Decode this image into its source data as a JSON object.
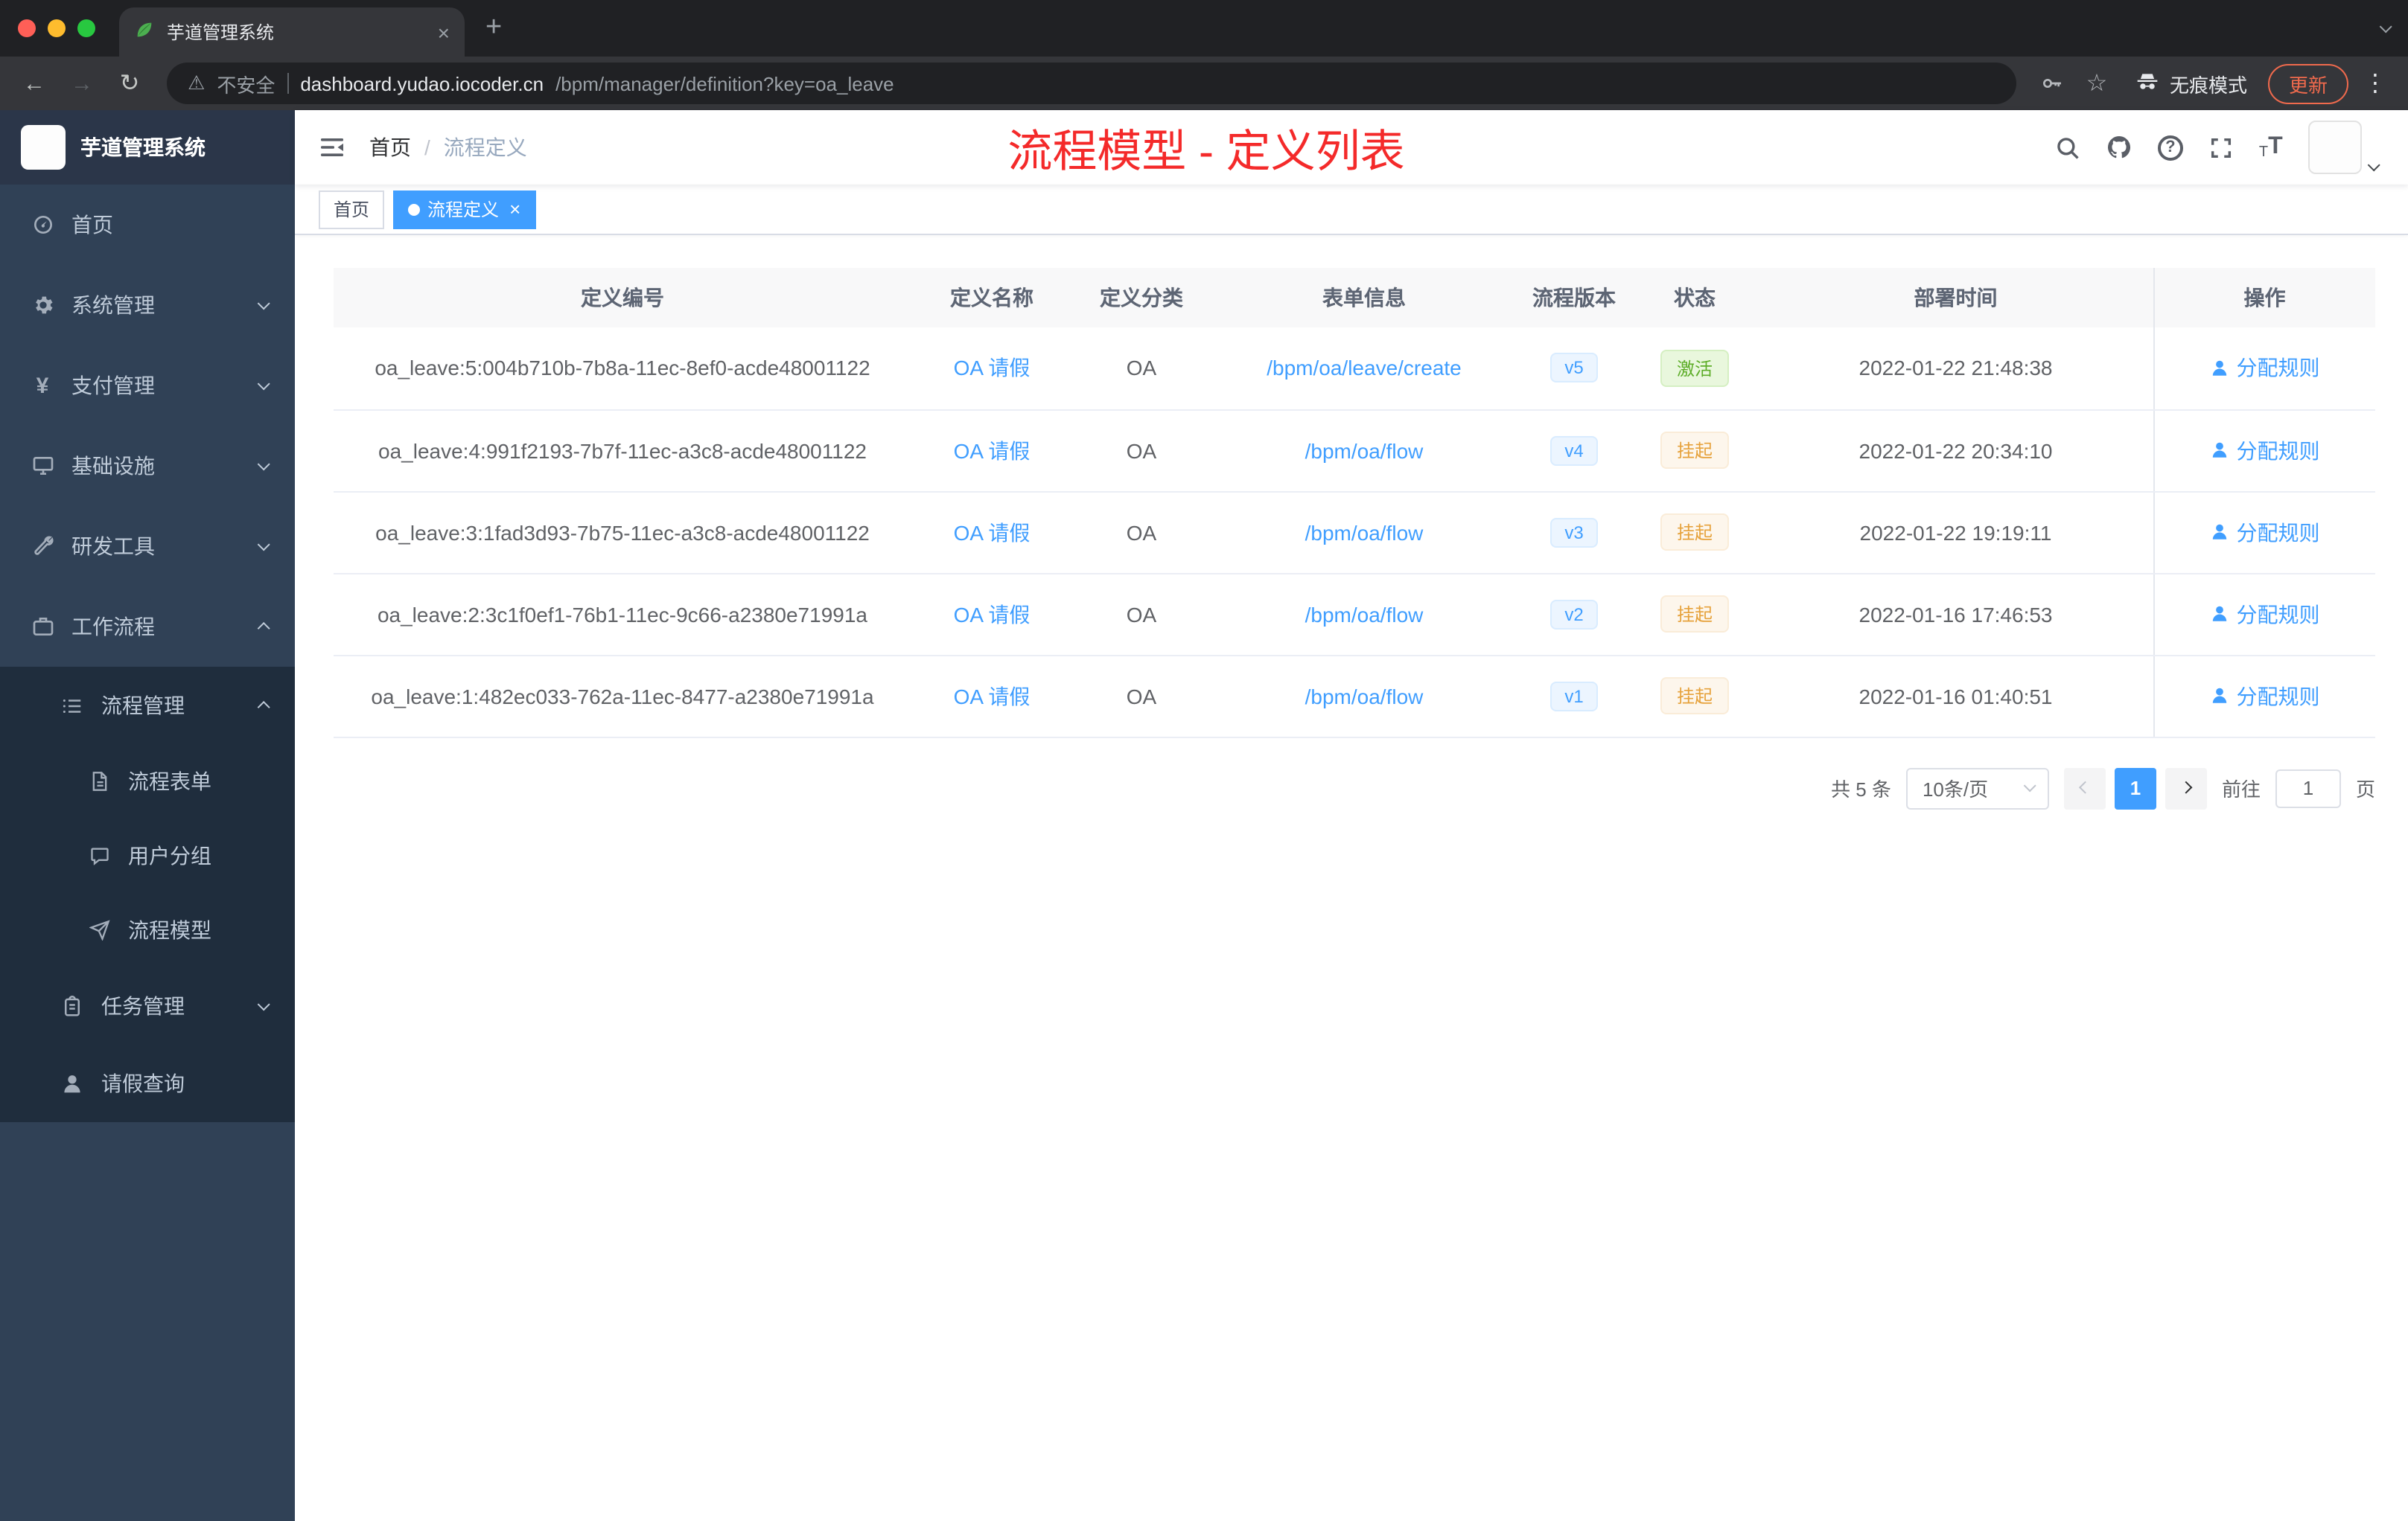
{
  "colors": {
    "accent": "#409eff",
    "success": "#67c23a",
    "warning": "#e6a23c",
    "title_red": "#f42a2a",
    "sidebar_bg": "#304156",
    "submenu_bg": "#1f2d3d"
  },
  "browser": {
    "tab": {
      "title": "芋道管理系统"
    },
    "address": {
      "security_label": "不安全",
      "domain": "dashboard.yudao.iocoder.cn",
      "path": "/bpm/manager/definition?key=oa_leave"
    },
    "incognito_label": "无痕模式",
    "update_label": "更新"
  },
  "sidebar": {
    "logo_title": "芋道管理系统",
    "items": [
      {
        "label": "首页"
      },
      {
        "label": "系统管理"
      },
      {
        "label": "支付管理"
      },
      {
        "label": "基础设施"
      },
      {
        "label": "研发工具"
      },
      {
        "label": "工作流程"
      },
      {
        "label": "流程管理"
      },
      {
        "label": "流程表单"
      },
      {
        "label": "用户分组"
      },
      {
        "label": "流程模型"
      },
      {
        "label": "任务管理"
      },
      {
        "label": "请假查询"
      }
    ]
  },
  "navbar": {
    "breadcrumb": {
      "home": "首页",
      "current": "流程定义"
    },
    "page_title": "流程模型 - 定义列表"
  },
  "tags": {
    "home": "首页",
    "active": "流程定义"
  },
  "table": {
    "columns": {
      "id": "定义编号",
      "name": "定义名称",
      "category": "定义分类",
      "form": "表单信息",
      "version": "流程版本",
      "status": "状态",
      "deploy_time": "部署时间",
      "action": "操作"
    },
    "rows": [
      {
        "id": "oa_leave:5:004b710b-7b8a-11ec-8ef0-acde48001122",
        "name": "OA 请假",
        "category": "OA",
        "form": "/bpm/oa/leave/create",
        "version": "v5",
        "status": "激活",
        "time": "2022-01-22 21:48:38",
        "action": "分配规则"
      },
      {
        "id": "oa_leave:4:991f2193-7b7f-11ec-a3c8-acde48001122",
        "name": "OA 请假",
        "category": "OA",
        "form": "/bpm/oa/flow",
        "version": "v4",
        "status": "挂起",
        "time": "2022-01-22 20:34:10",
        "action": "分配规则"
      },
      {
        "id": "oa_leave:3:1fad3d93-7b75-11ec-a3c8-acde48001122",
        "name": "OA 请假",
        "category": "OA",
        "form": "/bpm/oa/flow",
        "version": "v3",
        "status": "挂起",
        "time": "2022-01-22 19:19:11",
        "action": "分配规则"
      },
      {
        "id": "oa_leave:2:3c1f0ef1-76b1-11ec-9c66-a2380e71991a",
        "name": "OA 请假",
        "category": "OA",
        "form": "/bpm/oa/flow",
        "version": "v2",
        "status": "挂起",
        "time": "2022-01-16 17:46:53",
        "action": "分配规则"
      },
      {
        "id": "oa_leave:1:482ec033-762a-11ec-8477-a2380e71991a",
        "name": "OA 请假",
        "category": "OA",
        "form": "/bpm/oa/flow",
        "version": "v1",
        "status": "挂起",
        "time": "2022-01-16 01:40:51",
        "action": "分配规则"
      }
    ]
  },
  "pagination": {
    "total": "共 5 条",
    "page_size": "10条/页",
    "page": "1",
    "goto": "前往",
    "goto_value": "1",
    "unit": "页"
  }
}
